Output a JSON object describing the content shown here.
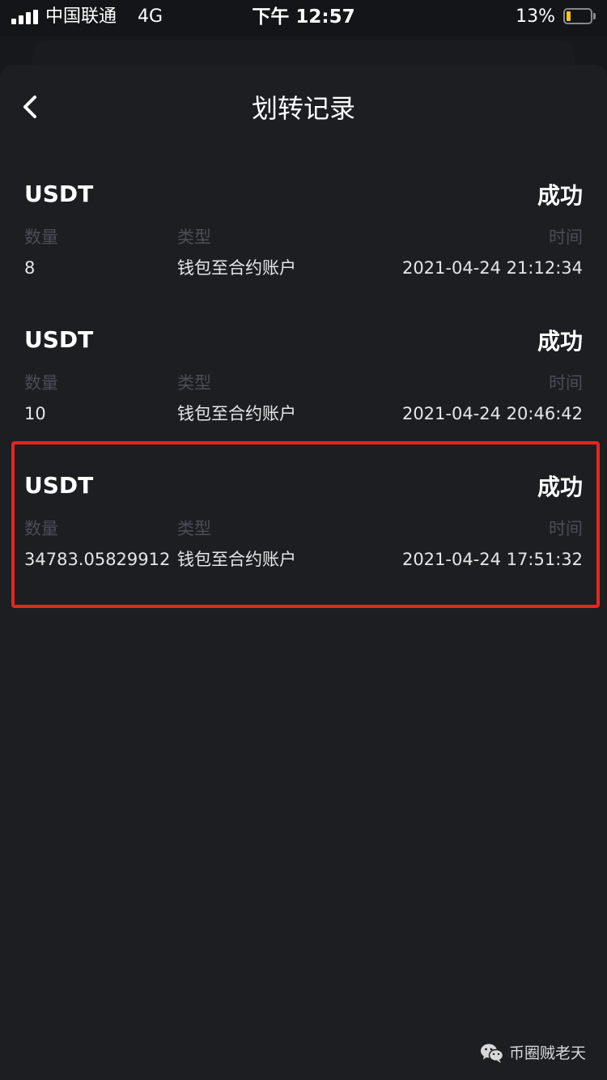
{
  "status_bar": {
    "carrier": "中国联通",
    "network": "4G",
    "time": "下午 12:57",
    "battery_percent": "13%",
    "signal_icon": "signal-bars-icon",
    "battery_icon": "battery-icon",
    "battery_level": 0.13,
    "battery_fill_color": "#f5c518"
  },
  "nav": {
    "back_icon": "chevron-left-icon",
    "title": "划转记录"
  },
  "labels": {
    "amount": "数量",
    "type": "类型",
    "time": "时间"
  },
  "records": [
    {
      "asset": "USDT",
      "status": "成功",
      "amount": "8",
      "type": "钱包至合约账户",
      "time": "2021-04-24 21:12:34"
    },
    {
      "asset": "USDT",
      "status": "成功",
      "amount": "10",
      "type": "钱包至合约账户",
      "time": "2021-04-24 20:46:42"
    },
    {
      "asset": "USDT",
      "status": "成功",
      "amount": "34783.05829912",
      "type": "钱包至合约账户",
      "time": "2021-04-24 17:51:32"
    }
  ],
  "annotation": {
    "highlight_color": "#e5261f"
  },
  "watermark": {
    "icon": "wechat-icon",
    "text": "币圈贼老天"
  }
}
